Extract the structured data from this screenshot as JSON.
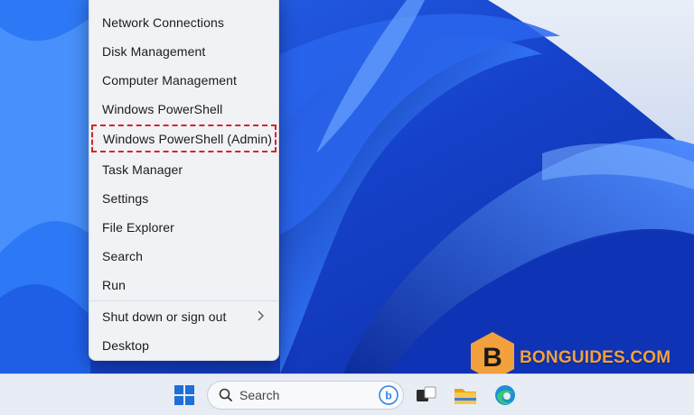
{
  "context_menu": {
    "items": [
      {
        "label": "Network Connections"
      },
      {
        "label": "Disk Management"
      },
      {
        "label": "Computer Management"
      },
      {
        "label": "Windows PowerShell"
      },
      {
        "label": "Windows PowerShell (Admin)",
        "highlighted": true
      },
      {
        "label": "Task Manager"
      },
      {
        "label": "Settings"
      },
      {
        "label": "File Explorer"
      },
      {
        "label": "Search"
      },
      {
        "label": "Run"
      },
      {
        "label": "Shut down or sign out",
        "has_submenu": true
      },
      {
        "label": "Desktop"
      }
    ]
  },
  "taskbar": {
    "start_icon": "windows-logo-icon",
    "search": {
      "placeholder": "Search",
      "icon": "search-icon",
      "bing_icon": "bing-icon"
    },
    "task_view_icon": "task-view-icon",
    "file_explorer_icon": "folder-icon",
    "edge_icon": "edge-icon"
  },
  "watermark": {
    "text": "BONGUIDES.COM",
    "color": "#f2a13c"
  },
  "colors": {
    "highlight_border": "#d8232a",
    "wallpaper_blue": "#1a4fd8"
  }
}
